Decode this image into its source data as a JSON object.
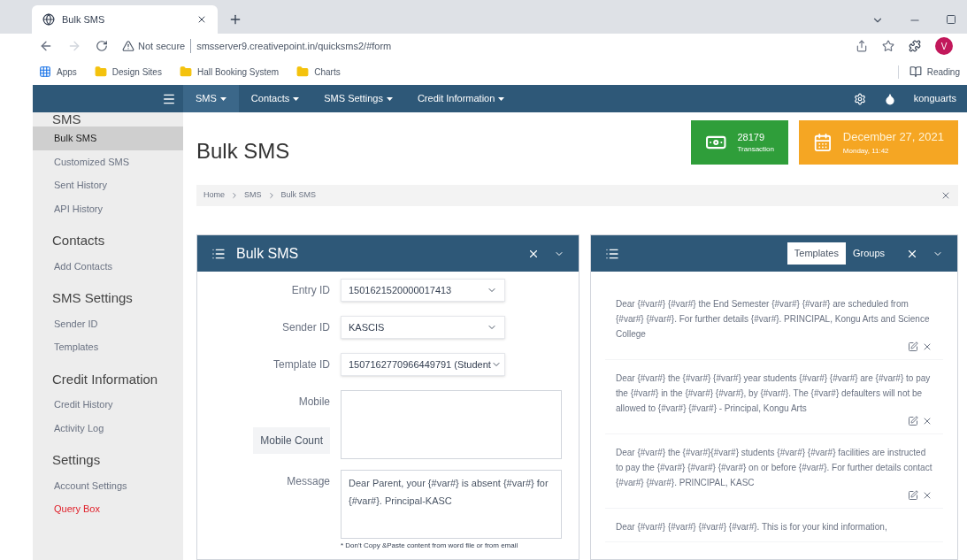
{
  "browser": {
    "tab_title": "Bulk SMS",
    "security": "Not secure",
    "url": "smsserver9.creativepoint.in/quicksms2/#form",
    "avatar": "V",
    "bookmarks": [
      {
        "label": "Apps",
        "kind": "apps"
      },
      {
        "label": "Design Sites",
        "kind": "folder"
      },
      {
        "label": "Hall Booking System",
        "kind": "folder"
      },
      {
        "label": "Charts",
        "kind": "folder"
      }
    ],
    "reading": "Reading"
  },
  "navbar": {
    "menus": [
      {
        "label": "SMS",
        "selected": true
      },
      {
        "label": "Contacts",
        "selected": false
      },
      {
        "label": "SMS Settings",
        "selected": false
      },
      {
        "label": "Credit Information",
        "selected": false
      }
    ],
    "user": "konguarts"
  },
  "sidebar": [
    {
      "heading": "SMS",
      "items": [
        {
          "label": "Bulk SMS",
          "selected": true,
          "kind": "link"
        },
        {
          "label": "Customized SMS",
          "selected": false,
          "kind": "link"
        },
        {
          "label": "Sent History",
          "selected": false,
          "kind": "link"
        },
        {
          "label": "API History",
          "selected": false,
          "kind": "link"
        }
      ]
    },
    {
      "heading": "Contacts",
      "items": [
        {
          "label": "Add Contacts",
          "selected": false,
          "kind": "link"
        }
      ]
    },
    {
      "heading": "SMS Settings",
      "items": [
        {
          "label": "Sender ID",
          "selected": false,
          "kind": "link"
        },
        {
          "label": "Templates",
          "selected": false,
          "kind": "link"
        }
      ]
    },
    {
      "heading": "Credit Information",
      "items": [
        {
          "label": "Credit History",
          "selected": false,
          "kind": "link"
        },
        {
          "label": "Activity Log",
          "selected": false,
          "kind": "link"
        }
      ]
    },
    {
      "heading": "Settings",
      "items": [
        {
          "label": "Account Settings",
          "selected": false,
          "kind": "link"
        },
        {
          "label": "Query Box",
          "selected": false,
          "kind": "alert"
        }
      ]
    }
  ],
  "page_title": "Bulk SMS",
  "stats": [
    {
      "value": "28179",
      "label": "Transaction",
      "kind": "money"
    },
    {
      "value": "December 27, 2021",
      "label": "Monday, 11:42",
      "kind": "calendar"
    }
  ],
  "breadcrumb": [
    "Home",
    "SMS",
    "Bulk SMS"
  ],
  "form_panel": {
    "title": "Bulk SMS",
    "fields": [
      {
        "label": "Entry ID",
        "kind": "select",
        "value": "1501621520000017413"
      },
      {
        "label": "Sender ID",
        "kind": "select",
        "value": "KASCIS"
      },
      {
        "label": "Template ID",
        "kind": "select",
        "value": "1507162770966449791 (Student"
      },
      {
        "label": "Mobile",
        "kind": "textarea",
        "button": "Mobile Count"
      },
      {
        "label": "Message",
        "kind": "textarea",
        "value": "Dear Parent, your {#var#} is absent {#var#} for {#var#}. Principal-KASC",
        "note": "* Don't Copy &Paste content from word file or from email"
      }
    ]
  },
  "templates_panel": {
    "tabs": [
      {
        "label": "Templates",
        "selected": true
      },
      {
        "label": "Groups",
        "selected": false
      }
    ],
    "templates": [
      "Dear {#var#} {#var#} the End Semester {#var#} {#var#} are scheduled from {#var#} {#var#}. For further details {#var#}. PRINCIPAL, Kongu Arts and Science College",
      "Dear {#var#} the {#var#} {#var#} year students {#var#} {#var#} are {#var#} to pay the {#var#} in the {#var#} {#var#}, by {#var#}. The {#var#} defaulters will not be allowed to {#var#} {#var#} - Principal, Kongu Arts",
      "Dear {#var#} the {#var#}{#var#} students {#var#} {#var#} facilities are instructed to pay the {#var#} {#var#} {#var#} on or before {#var#}. For further details contact {#var#} {#var#}. PRINCIPAL, KASC",
      "Dear {#var#} {#var#} {#var#} {#var#}. This is for your kind information,"
    ]
  }
}
